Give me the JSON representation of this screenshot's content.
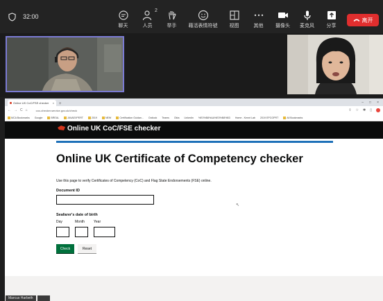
{
  "meeting": {
    "timer": "32:00",
    "toolbar": [
      {
        "icon": "chat-icon",
        "label": "聊天"
      },
      {
        "icon": "participants-icon",
        "label": "人员",
        "count": "2"
      },
      {
        "icon": "raise-hand-icon",
        "label": "举手"
      },
      {
        "icon": "reactions-icon",
        "label": "藉活表情符號"
      },
      {
        "icon": "view-icon",
        "label": "视图"
      },
      {
        "icon": "more-icon",
        "label": "其他"
      }
    ],
    "controls": [
      {
        "icon": "camera-icon",
        "label": "摄像头"
      },
      {
        "icon": "mic-icon",
        "label": "麦克风"
      },
      {
        "icon": "share-icon",
        "label": "分享"
      }
    ],
    "leave_label": "离开",
    "participant_name": "Marcus Harbeth"
  },
  "browser": {
    "tab_title": "Online UK CoC/FSE checker",
    "url": "coc-checker.service.gov.uk/check",
    "bookmarks": [
      "MCA Bookmarks",
      "Google",
      "BREAL",
      "JAVAEXPERT",
      "2019",
      "NEW",
      "Certification Guidan...",
      "Outlook",
      "Teams",
      "Okta",
      "Linkedin",
      "%E0%B8%AA%E0%B8%B3",
      "Home - Kennt Lab",
      "2019 EPCGPRT",
      "All Bookmarks"
    ]
  },
  "page": {
    "header_title": "Online UK CoC/FSE checker",
    "heading": "Online UK Certificate of Competency checker",
    "intro": "Use this page to verify Certificates of Competency (CoC) and Flag State Endorsements (FSE) online.",
    "document_id_label": "Document ID",
    "document_id_value": "",
    "dob_label": "Seafarer's date of birth",
    "day_label": "Day",
    "month_label": "Month",
    "year_label": "Year",
    "check_label": "Check",
    "reset_label": "Reset"
  },
  "colors": {
    "gov_black": "#0b0c0c",
    "gov_blue": "#1d70b8",
    "gov_green": "#00703c",
    "end_red": "#e02e2e"
  }
}
